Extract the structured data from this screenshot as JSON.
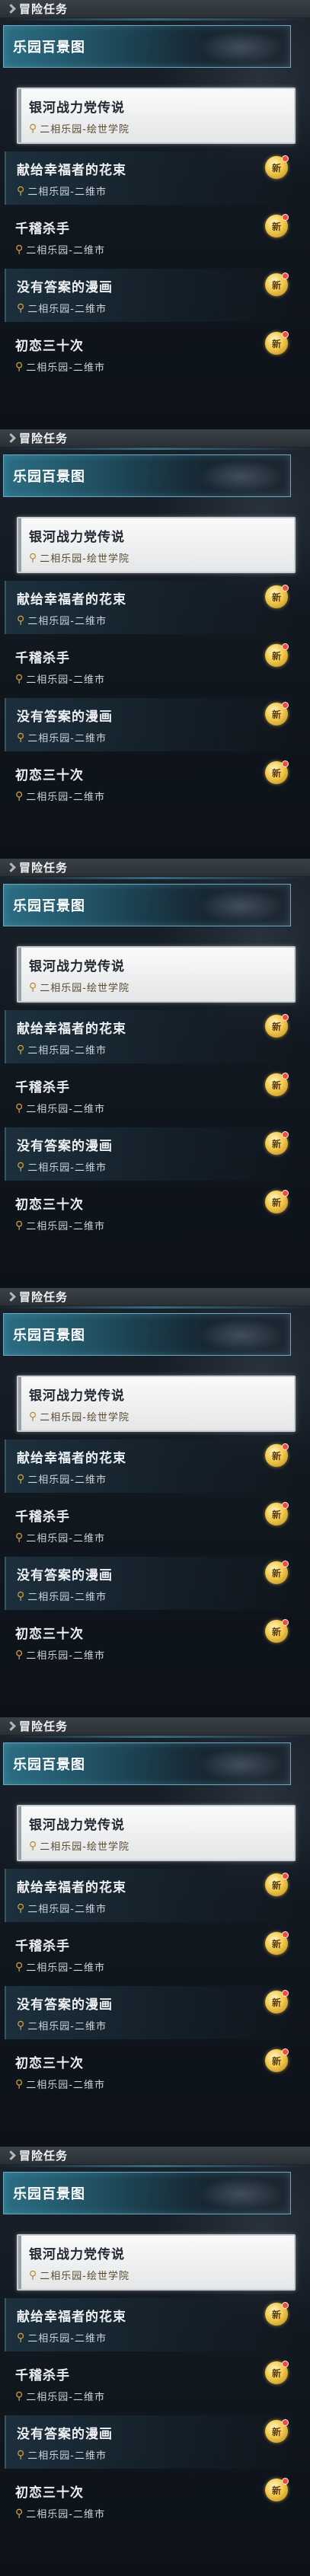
{
  "panels": [
    {
      "header": "冒险任务",
      "tab": "乐园百景图",
      "selected": {
        "title": "银河战力党传说",
        "location": "二相乐园-绘世学院"
      },
      "quests": [
        {
          "title": "献给幸福者的花束",
          "location": "二相乐园-二维市",
          "badge": "新"
        },
        {
          "title": "千稽杀手",
          "location": "二相乐园-二维市",
          "badge": "新"
        },
        {
          "title": "没有答案的漫画",
          "location": "二相乐园-二维市",
          "badge": "新"
        },
        {
          "title": "初恋三十次",
          "location": "二相乐园-二维市",
          "badge": "新"
        }
      ]
    },
    {
      "header": "冒险任务",
      "tab": "乐园百景图",
      "selected": {
        "title": "银河战力党传说",
        "location": "二相乐园-绘世学院"
      },
      "quests": [
        {
          "title": "献给幸福者的花束",
          "location": "二相乐园-二维市",
          "badge": "新"
        },
        {
          "title": "千稽杀手",
          "location": "二相乐园-二维市",
          "badge": "新"
        },
        {
          "title": "没有答案的漫画",
          "location": "二相乐园-二维市",
          "badge": "新"
        },
        {
          "title": "初恋三十次",
          "location": "二相乐园-二维市",
          "badge": "新"
        }
      ]
    },
    {
      "header": "冒险任务",
      "tab": "乐园百景图",
      "selected": {
        "title": "银河战力党传说",
        "location": "二相乐园-绘世学院"
      },
      "quests": [
        {
          "title": "献给幸福者的花束",
          "location": "二相乐园-二维市",
          "badge": "新"
        },
        {
          "title": "千稽杀手",
          "location": "二相乐园-二维市",
          "badge": "新"
        },
        {
          "title": "没有答案的漫画",
          "location": "二相乐园-二维市",
          "badge": "新"
        },
        {
          "title": "初恋三十次",
          "location": "二相乐园-二维市",
          "badge": "新"
        }
      ]
    },
    {
      "header": "冒险任务",
      "tab": "乐园百景图",
      "selected": {
        "title": "银河战力党传说",
        "location": "二相乐园-绘世学院"
      },
      "quests": [
        {
          "title": "献给幸福者的花束",
          "location": "二相乐园-二维市",
          "badge": "新"
        },
        {
          "title": "千稽杀手",
          "location": "二相乐园-二维市",
          "badge": "新"
        },
        {
          "title": "没有答案的漫画",
          "location": "二相乐园-二维市",
          "badge": "新"
        },
        {
          "title": "初恋三十次",
          "location": "二相乐园-二维市",
          "badge": "新"
        }
      ]
    },
    {
      "header": "冒险任务",
      "tab": "乐园百景图",
      "selected": {
        "title": "银河战力党传说",
        "location": "二相乐园-绘世学院"
      },
      "quests": [
        {
          "title": "献给幸福者的花束",
          "location": "二相乐园-二维市",
          "badge": "新"
        },
        {
          "title": "千稽杀手",
          "location": "二相乐园-二维市",
          "badge": "新"
        },
        {
          "title": "没有答案的漫画",
          "location": "二相乐园-二维市",
          "badge": "新"
        },
        {
          "title": "初恋三十次",
          "location": "二相乐园-二维市",
          "badge": "新"
        }
      ]
    },
    {
      "header": "冒险任务",
      "tab": "乐园百景图",
      "selected": {
        "title": "银河战力党传说",
        "location": "二相乐园-绘世学院"
      },
      "quests": [
        {
          "title": "献给幸福者的花束",
          "location": "二相乐园-二维市",
          "badge": "新"
        },
        {
          "title": "千稽杀手",
          "location": "二相乐园-二维市",
          "badge": "新"
        },
        {
          "title": "没有答案的漫画",
          "location": "二相乐园-二维市",
          "badge": "新"
        },
        {
          "title": "初恋三十次",
          "location": "二相乐园-二维市",
          "badge": "新"
        }
      ]
    }
  ],
  "icons": {
    "location": "map-pin-icon",
    "new": "new-badge-icon"
  },
  "colors": {
    "accent": "#2c6e84",
    "badge": "#f2c94c",
    "pin": "#d2a240"
  }
}
